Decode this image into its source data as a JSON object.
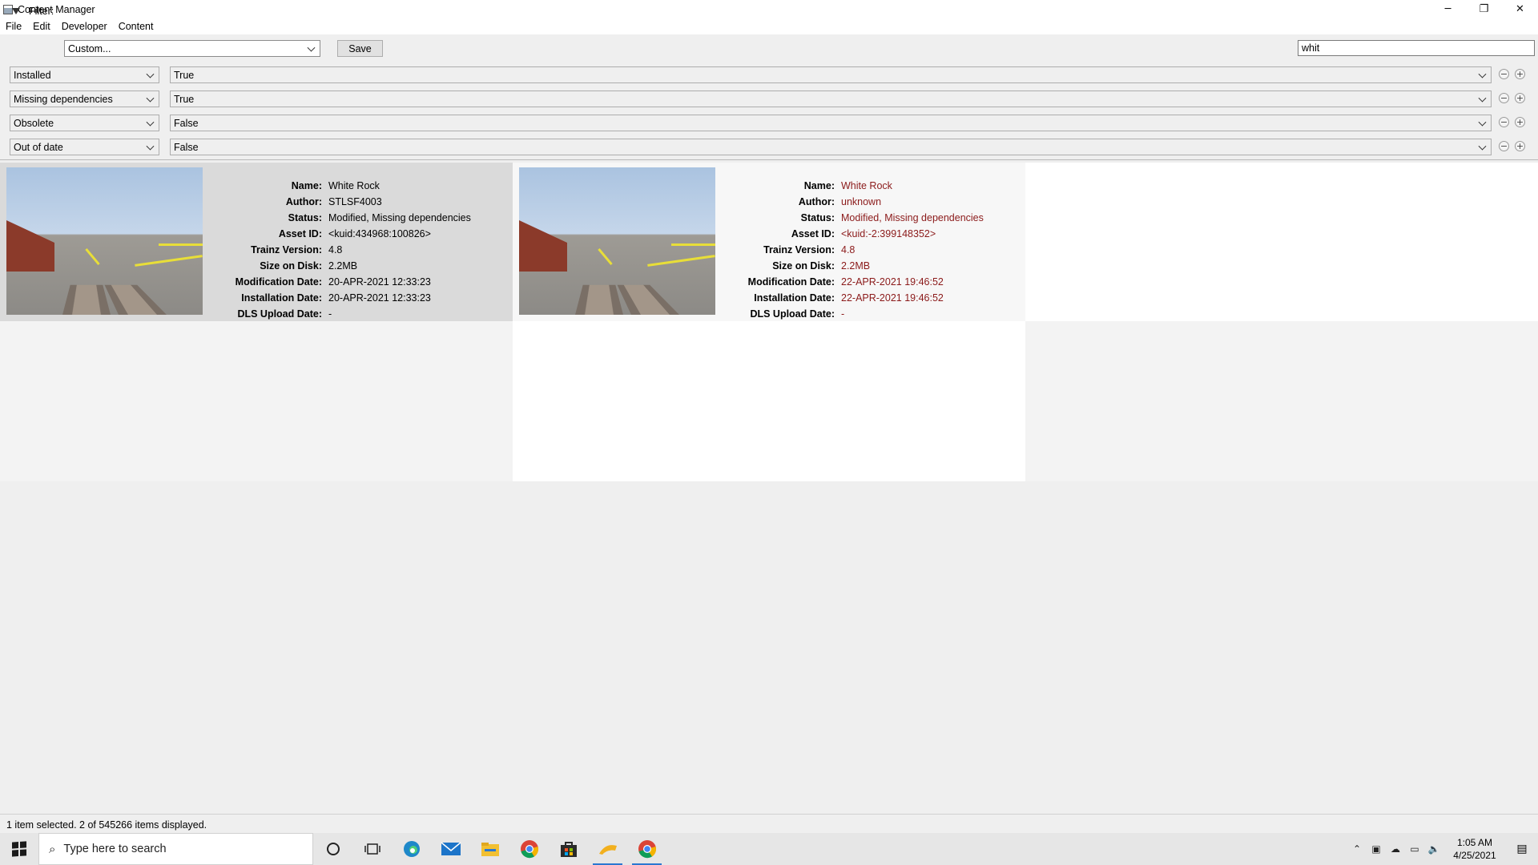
{
  "window": {
    "title": "Content Manager",
    "minimize_glyph": "─",
    "restore_glyph": "❐",
    "close_glyph": "✕"
  },
  "menu": [
    "File",
    "Edit",
    "Developer",
    "Content"
  ],
  "filter": {
    "label": "Filter:",
    "preset_value": "Custom...",
    "save_label": "Save",
    "search_value": "whit"
  },
  "conditions": [
    {
      "field": "Installed",
      "value": "True"
    },
    {
      "field": "Missing dependencies",
      "value": "True"
    },
    {
      "field": "Obsolete",
      "value": "False"
    },
    {
      "field": "Out of date",
      "value": "False"
    }
  ],
  "labels": {
    "name": "Name:",
    "author": "Author:",
    "status": "Status:",
    "asset_id": "Asset ID:",
    "trainz_version": "Trainz Version:",
    "size": "Size on Disk:",
    "modification": "Modification Date:",
    "installation": "Installation Date:",
    "dls": "DLS Upload Date:"
  },
  "items": [
    {
      "name": "White Rock",
      "author": "STLSF4003",
      "status": "Modified, Missing dependencies",
      "asset_id": "<kuid:434968:100826>",
      "trainz_version": "4.8",
      "size": "2.2MB",
      "modification": "20-APR-2021 12:33:23",
      "installation": "20-APR-2021 12:33:23",
      "dls": "-",
      "selected": true
    },
    {
      "name": "White Rock",
      "author": "unknown",
      "status": "Modified, Missing dependencies",
      "asset_id": "<kuid:-2:399148352>",
      "trainz_version": "4.8",
      "size": "2.2MB",
      "modification": "22-APR-2021 19:46:52",
      "installation": "22-APR-2021 19:46:52",
      "dls": "-",
      "selected": false
    }
  ],
  "status_bar": "1 item selected. 2 of 545266 items displayed.",
  "taskbar": {
    "search_placeholder": "Type here to search",
    "time": "1:05 AM",
    "date": "4/25/2021",
    "icons": [
      "cortana-icon",
      "task-view-icon",
      "edge-icon",
      "mail-icon",
      "file-explorer-icon",
      "chrome-icon",
      "store-icon",
      "trainz-icon",
      "chrome-icon"
    ]
  },
  "colors": {
    "accent": "#2b78d1",
    "item_text_highlight": "#8b1a1a",
    "selected_card": "#dadada"
  }
}
